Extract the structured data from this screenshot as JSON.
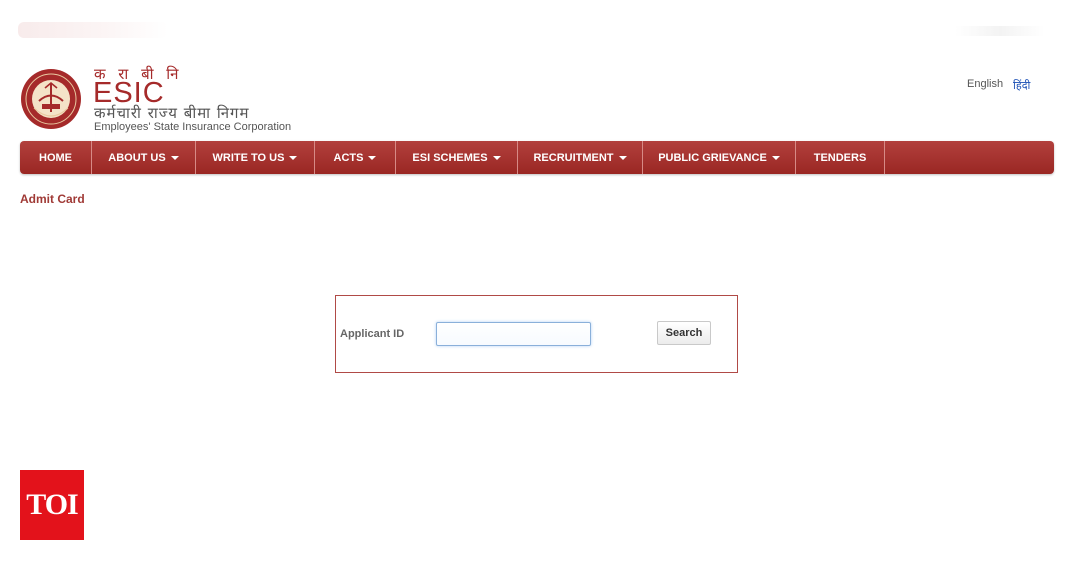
{
  "header": {
    "brand_hindi_short": "क रा बी नि",
    "brand_name": "ESIC",
    "brand_hindi_full": "कर्मचारी राज्य बीमा निगम",
    "brand_english": "Employees' State Insurance Corporation",
    "logo_icon": "esic-emblem-icon"
  },
  "languages": {
    "english": "English",
    "hindi": "हिंदी"
  },
  "nav": {
    "items": [
      {
        "label": "HOME",
        "dropdown": false
      },
      {
        "label": "ABOUT US",
        "dropdown": true
      },
      {
        "label": "WRITE TO US",
        "dropdown": true
      },
      {
        "label": "ACTS",
        "dropdown": true
      },
      {
        "label": "ESI SCHEMES",
        "dropdown": true
      },
      {
        "label": "RECRUITMENT",
        "dropdown": true
      },
      {
        "label": "PUBLIC GRIEVANCE",
        "dropdown": true
      },
      {
        "label": "TENDERS",
        "dropdown": false
      }
    ]
  },
  "page": {
    "title": "Admit Card"
  },
  "search_form": {
    "label": "Applicant ID",
    "input_value": "",
    "button_label": "Search"
  },
  "watermark": {
    "text": "TOI"
  },
  "colors": {
    "brand": "#a52a2a",
    "nav_bg": "#a8322e",
    "toi_red": "#e3121b",
    "link_blue": "#1a4fb5"
  }
}
